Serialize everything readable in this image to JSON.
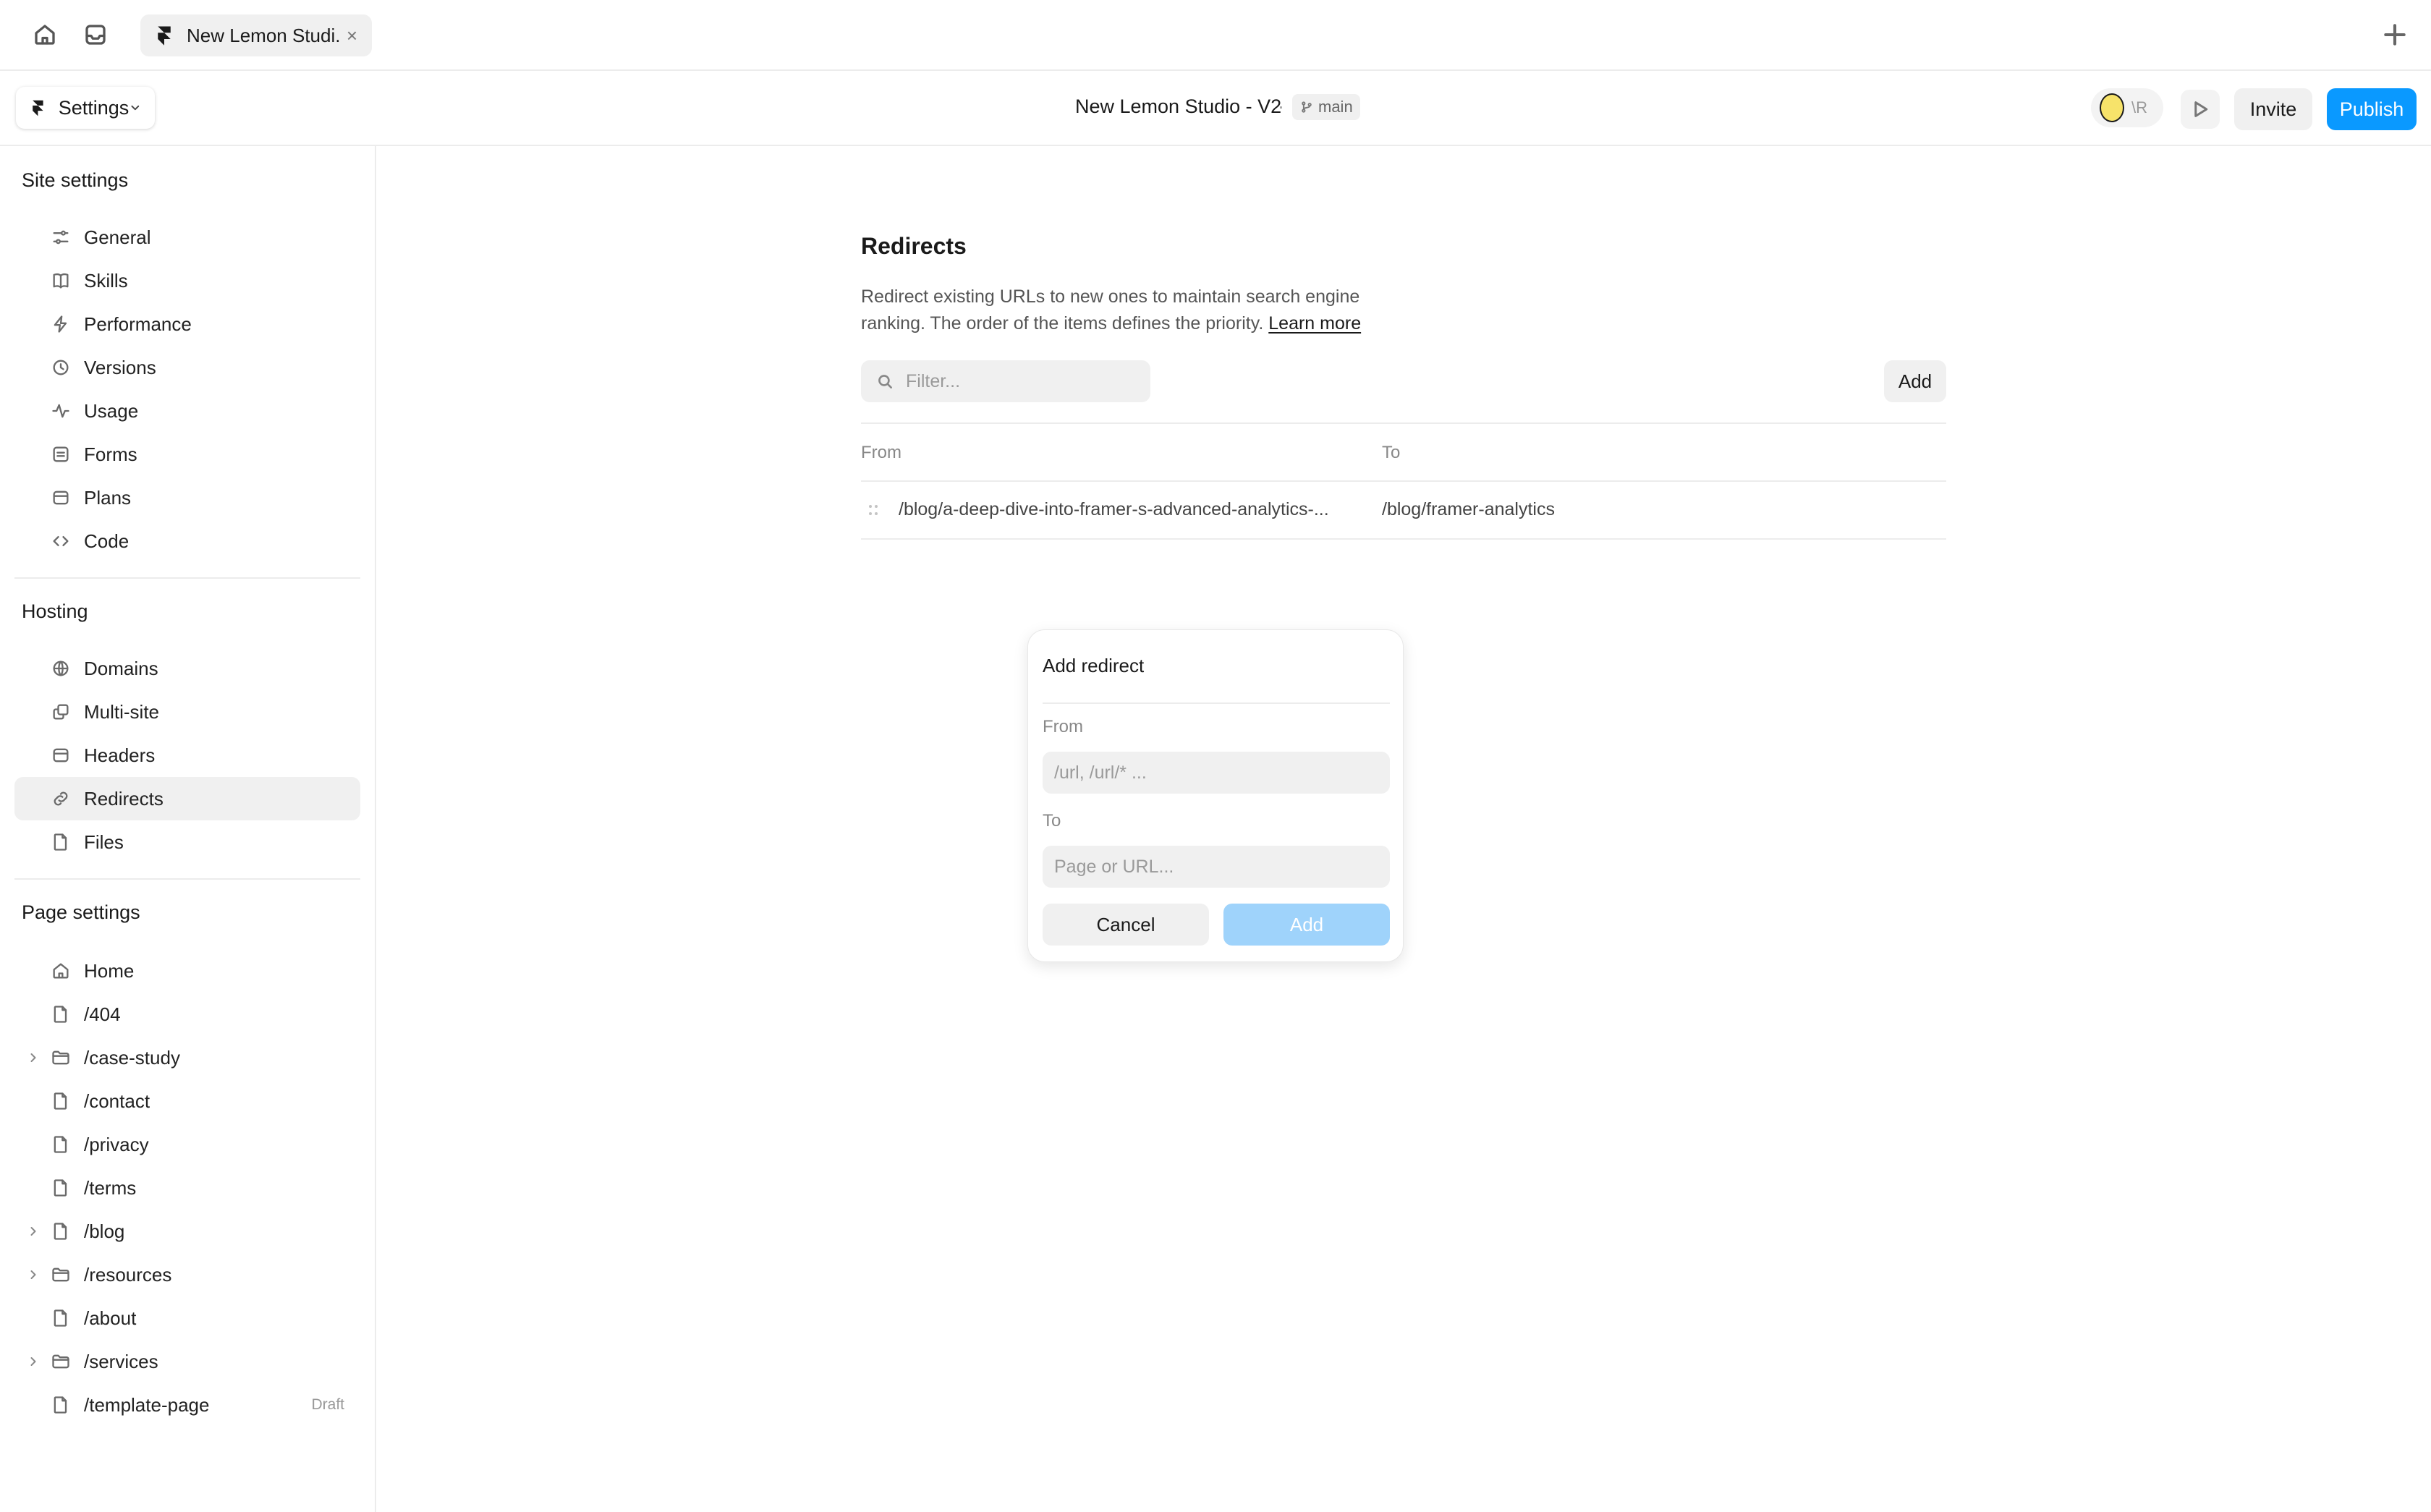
{
  "tabbar": {
    "doc_tab_title": "New Lemon Studi...",
    "close_symbol": "×",
    "icons": [
      "home-icon",
      "inbox-icon",
      "plus-icon"
    ]
  },
  "toolbar": {
    "settings_label": "Settings",
    "project_title": "New Lemon Studio - V2",
    "separator": "·",
    "branch": "main",
    "avatar_initials": "\\R",
    "invite_label": "Invite",
    "publish_label": "Publish",
    "accent_color": "#0a99ff",
    "avatar_color": "#f7e36a"
  },
  "sidebar": {
    "site_settings_title": "Site settings",
    "site_items": [
      {
        "label": "General",
        "icon": "sliders-icon"
      },
      {
        "label": "Skills",
        "icon": "book-icon"
      },
      {
        "label": "Performance",
        "icon": "bolt-icon"
      },
      {
        "label": "Versions",
        "icon": "clock-icon"
      },
      {
        "label": "Usage",
        "icon": "pulse-icon"
      },
      {
        "label": "Forms",
        "icon": "form-icon"
      },
      {
        "label": "Plans",
        "icon": "card-icon"
      },
      {
        "label": "Code",
        "icon": "code-icon"
      }
    ],
    "hosting_title": "Hosting",
    "hosting_items": [
      {
        "label": "Domains",
        "icon": "globe-icon"
      },
      {
        "label": "Multi-site",
        "icon": "copy-icon"
      },
      {
        "label": "Headers",
        "icon": "card-icon"
      },
      {
        "label": "Redirects",
        "icon": "link-icon",
        "active": true
      },
      {
        "label": "Files",
        "icon": "file-icon"
      }
    ],
    "page_settings_title": "Page settings",
    "page_items": [
      {
        "label": "Home",
        "icon": "home-icon"
      },
      {
        "label": "/404",
        "icon": "file-icon"
      },
      {
        "label": "/case-study",
        "icon": "folder-icon",
        "expandable": true
      },
      {
        "label": "/contact",
        "icon": "file-icon"
      },
      {
        "label": "/privacy",
        "icon": "file-icon"
      },
      {
        "label": "/terms",
        "icon": "file-icon"
      },
      {
        "label": "/blog",
        "icon": "file-icon",
        "expandable": true
      },
      {
        "label": "/resources",
        "icon": "folder-icon",
        "expandable": true
      },
      {
        "label": "/about",
        "icon": "file-icon"
      },
      {
        "label": "/services",
        "icon": "folder-icon",
        "expandable": true
      },
      {
        "label": "/template-page",
        "icon": "file-icon",
        "tag": "Draft"
      }
    ]
  },
  "redirects": {
    "title": "Redirects",
    "description": "Redirect existing URLs to new ones to maintain search engine ranking. The order of the items defines the priority.",
    "learn_more": "Learn more",
    "filter_placeholder": "Filter...",
    "add_label": "Add",
    "columns": {
      "from": "From",
      "to": "To"
    },
    "rows": [
      {
        "from": "/blog/a-deep-dive-into-framer-s-advanced-analytics-...",
        "to": "/blog/framer-analytics"
      }
    ]
  },
  "modal": {
    "title": "Add redirect",
    "from_label": "From",
    "from_placeholder": "/url, /url/* ...",
    "to_label": "To",
    "to_placeholder": "Page or URL...",
    "cancel_label": "Cancel",
    "add_label": "Add",
    "add_disabled_color": "#9fd3fb"
  }
}
